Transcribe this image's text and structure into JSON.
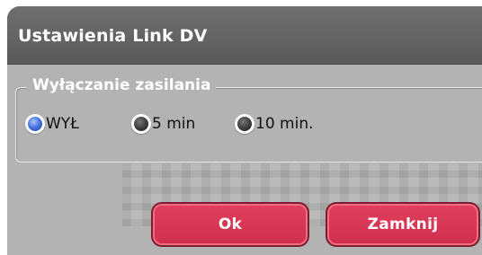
{
  "dialog": {
    "title": "Ustawienia Link DV",
    "group_label": "Wyłączanie zasilania",
    "options": [
      {
        "label": "WYŁ",
        "selected": true
      },
      {
        "label": "5 min",
        "selected": false
      },
      {
        "label": "10 min.",
        "selected": false
      }
    ],
    "buttons": {
      "ok_label": "Ok",
      "close_label": "Zamknij"
    }
  },
  "colors": {
    "titlebar": "#666666",
    "body": "#b3b3b3",
    "button": "#d93551",
    "selected_radio": "#4a78e0"
  }
}
